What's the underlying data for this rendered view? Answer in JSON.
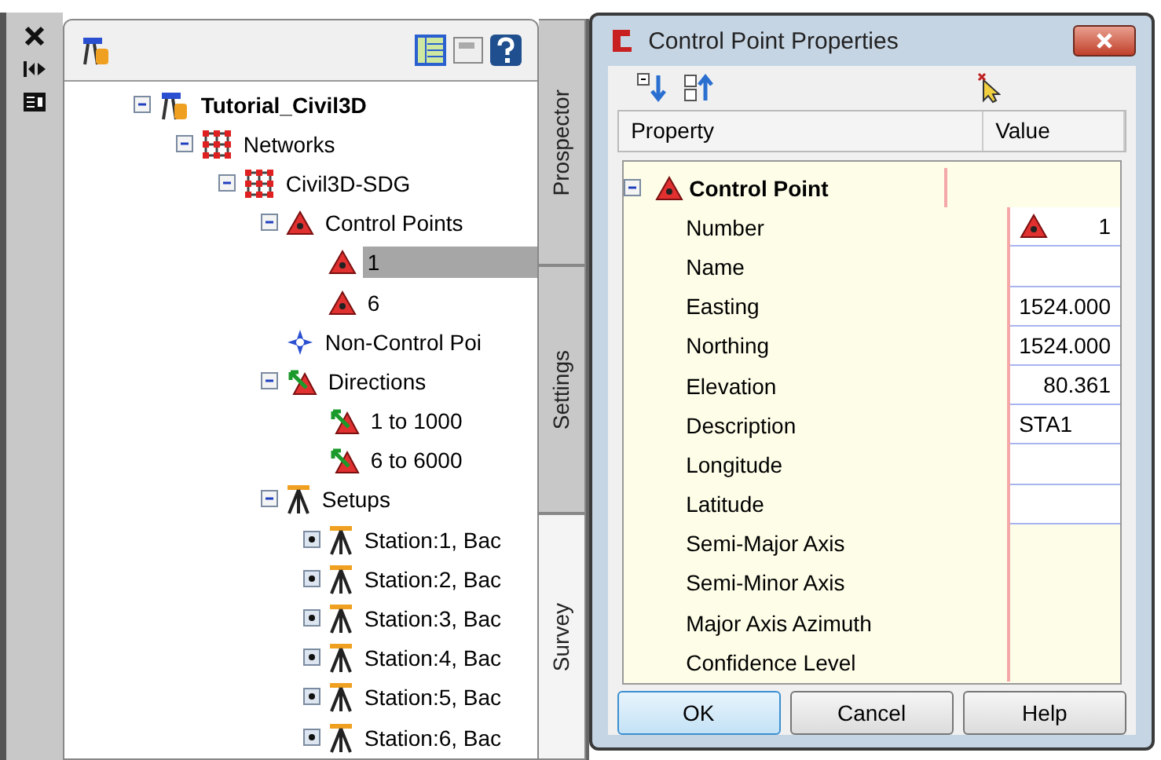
{
  "tree": [
    {
      "label": "Tutorial_Civil3D",
      "kind": "project",
      "expanded": true,
      "selected": false,
      "children": [
        {
          "label": "Networks",
          "kind": "network",
          "expanded": true,
          "selected": false,
          "children": [
            {
              "label": "Civil3D-SDG",
              "kind": "network",
              "expanded": true,
              "selected": false,
              "children": [
                {
                  "label": "Control Points",
                  "kind": "control",
                  "expanded": true,
                  "selected": false,
                  "children": [
                    {
                      "label": "1",
                      "kind": "point",
                      "selected": true
                    },
                    {
                      "label": "6",
                      "kind": "point",
                      "selected": false
                    }
                  ]
                },
                {
                  "label": "Non-Control Poi",
                  "kind": "noncontrol",
                  "selected": false
                },
                {
                  "label": "Directions",
                  "kind": "direction",
                  "expanded": true,
                  "selected": false,
                  "children": [
                    {
                      "label": "1 to 1000",
                      "kind": "direction",
                      "selected": false
                    },
                    {
                      "label": "6 to 6000",
                      "kind": "direction",
                      "selected": false
                    }
                  ]
                },
                {
                  "label": "Setups",
                  "kind": "setup",
                  "expanded": true,
                  "selected": false,
                  "children": [
                    {
                      "label": "Station:1, Bac",
                      "kind": "setup",
                      "expanded": false,
                      "selected": false
                    },
                    {
                      "label": "Station:2, Bac",
                      "kind": "setup",
                      "expanded": false,
                      "selected": false
                    },
                    {
                      "label": "Station:3, Bac",
                      "kind": "setup",
                      "expanded": false,
                      "selected": false
                    },
                    {
                      "label": "Station:4, Bac",
                      "kind": "setup",
                      "expanded": false,
                      "selected": false
                    },
                    {
                      "label": "Station:5, Bac",
                      "kind": "setup",
                      "expanded": false,
                      "selected": false
                    },
                    {
                      "label": "Station:6, Bac",
                      "kind": "setup",
                      "expanded": false,
                      "selected": false
                    }
                  ]
                }
              ]
            }
          ]
        }
      ]
    }
  ],
  "tabs": [
    {
      "label": "Prospector",
      "selected": false
    },
    {
      "label": "Settings",
      "selected": false
    },
    {
      "label": "Survey",
      "selected": true
    }
  ],
  "dialog": {
    "title": "Control Point Properties",
    "columns": [
      "Property",
      "Value"
    ],
    "group": {
      "label": "Control Point",
      "expanded": true
    },
    "rows": [
      {
        "name": "Number",
        "value": "1",
        "editable": true,
        "kind": "point"
      },
      {
        "name": "Name",
        "editable": true
      },
      {
        "name": "Easting",
        "value": "1524.000",
        "editable": true
      },
      {
        "name": "Northing",
        "value": "1524.000",
        "editable": true
      },
      {
        "name": "Elevation",
        "value": "80.361",
        "editable": true
      },
      {
        "name": "Description",
        "value": "STA1",
        "editable": true,
        "kind": "text"
      },
      {
        "name": "Longitude",
        "editable": true
      },
      {
        "name": "Latitude",
        "editable": true
      },
      {
        "name": "Semi-Major Axis",
        "editable": false
      },
      {
        "name": "Semi-Minor Axis",
        "editable": false
      },
      {
        "name": "Major Axis Azimuth",
        "editable": false
      },
      {
        "name": "Confidence Level",
        "editable": false
      }
    ],
    "buttons": [
      {
        "label": "OK",
        "selected": true
      },
      {
        "label": "Cancel",
        "selected": false
      },
      {
        "label": "Help",
        "selected": false
      }
    ]
  }
}
